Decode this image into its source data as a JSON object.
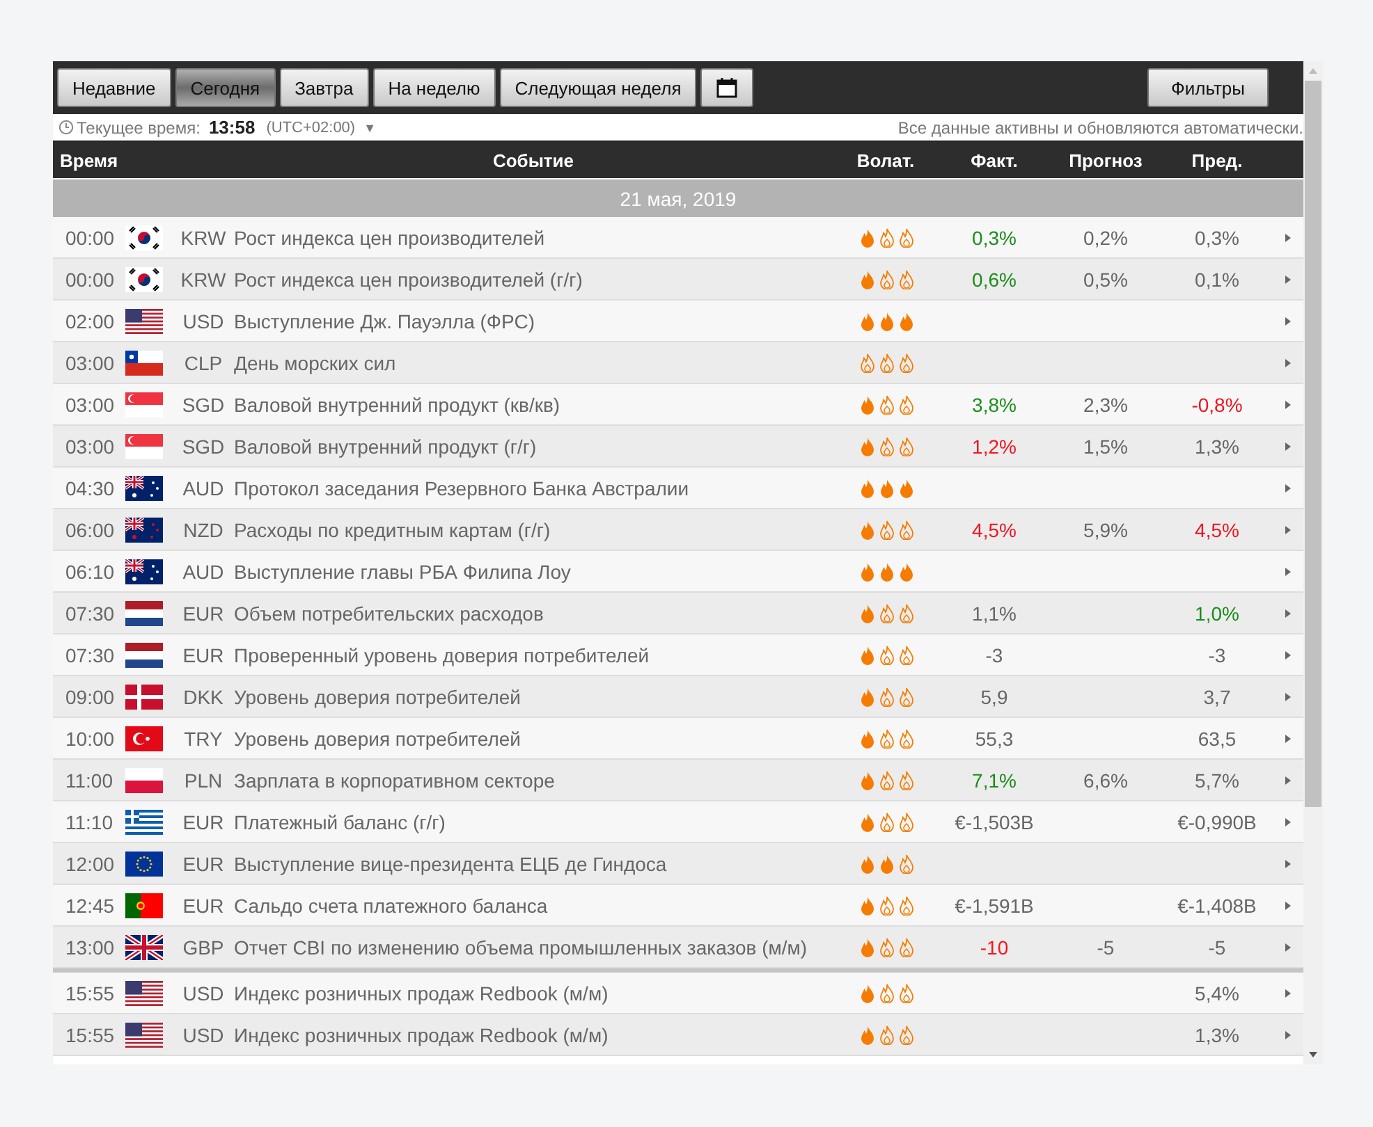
{
  "toolbar": {
    "tabs": [
      {
        "label": "Недавние",
        "selected": false
      },
      {
        "label": "Сегодня",
        "selected": true
      },
      {
        "label": "Завтра",
        "selected": false
      },
      {
        "label": "На неделю",
        "selected": false
      },
      {
        "label": "Следующая неделя",
        "selected": false
      }
    ],
    "filters_button": "Фильтры"
  },
  "info": {
    "clock_label": "Текущее время:",
    "time": "13:58",
    "timezone": "(UTC+02:00)",
    "timezone_caret": "▼",
    "status": "Все данные активны и обновляются автоматически."
  },
  "table": {
    "columns": [
      "Время",
      "Событие",
      "Волат.",
      "Факт.",
      "Прогноз",
      "Пред."
    ],
    "date": "21 мая, 2019",
    "rows": [
      {
        "time": "00:00",
        "kind": "kr",
        "currency": "KRW",
        "event": "Рост индекса цен производителей",
        "stars": 1,
        "actual": {
          "text": "0,3%",
          "color": "#1a8c1a"
        },
        "forecast": "0,2%",
        "previous": {
          "text": "0,3%",
          "color": "#666666"
        }
      },
      {
        "time": "00:00",
        "kind": "kr",
        "currency": "KRW",
        "event": "Рост индекса цен производителей (г/г)",
        "stars": 1,
        "actual": {
          "text": "0,6%",
          "color": "#1a8c1a"
        },
        "forecast": "0,5%",
        "previous": {
          "text": "0,1%",
          "color": "#666666"
        }
      },
      {
        "time": "02:00",
        "kind": "us",
        "currency": "USD",
        "event": "Выступление Дж. Пауэлла (ФРС)",
        "stars": 3
      },
      {
        "time": "03:00",
        "kind": "cl",
        "currency": "CLP",
        "event": "День морских сил",
        "stars": 0
      },
      {
        "time": "03:00",
        "kind": "sg",
        "currency": "SGD",
        "event": "Валовой внутренний продукт (кв/кв)",
        "stars": 1,
        "actual": {
          "text": "3,8%",
          "color": "#1a8c1a"
        },
        "forecast": "2,3%",
        "previous": {
          "text": "-0,8%",
          "color": "#f0141e"
        }
      },
      {
        "time": "03:00",
        "kind": "sg",
        "currency": "SGD",
        "event": "Валовой внутренний продукт (г/г)",
        "stars": 1,
        "actual": {
          "text": "1,2%",
          "color": "#f0141e"
        },
        "forecast": "1,5%",
        "previous": {
          "text": "1,3%",
          "color": "#666666"
        }
      },
      {
        "time": "04:30",
        "kind": "au",
        "currency": "AUD",
        "event": "Протокол заседания Резервного Банка Австралии",
        "stars": 3
      },
      {
        "time": "06:00",
        "kind": "nz",
        "currency": "NZD",
        "event": "Расходы по кредитным картам (г/г)",
        "stars": 1,
        "actual": {
          "text": "4,5%",
          "color": "#f0141e"
        },
        "forecast": "5,9%",
        "previous": {
          "text": "4,5%",
          "color": "#f0141e"
        }
      },
      {
        "time": "06:10",
        "kind": "au",
        "currency": "AUD",
        "event": "Выступление главы РБА Филипа Лоу",
        "stars": 3
      },
      {
        "time": "07:30",
        "kind": "nl",
        "currency": "EUR",
        "event": "Объем потребительских расходов",
        "stars": 1,
        "actual": {
          "text": "1,1%",
          "color": "#666666"
        },
        "previous": {
          "text": "1,0%",
          "color": "#1a8c1a"
        }
      },
      {
        "time": "07:30",
        "kind": "nl",
        "currency": "EUR",
        "event": "Проверенный уровень доверия потребителей",
        "stars": 1,
        "actual": {
          "text": "-3",
          "color": "#666666"
        },
        "previous": {
          "text": "-3",
          "color": "#666666"
        }
      },
      {
        "time": "09:00",
        "kind": "dk",
        "currency": "DKK",
        "event": "Уровень доверия потребителей",
        "stars": 1,
        "actual": {
          "text": "5,9",
          "color": "#666666"
        },
        "previous": {
          "text": "3,7",
          "color": "#666666"
        }
      },
      {
        "time": "10:00",
        "kind": "tr",
        "currency": "TRY",
        "event": "Уровень доверия потребителей",
        "stars": 1,
        "actual": {
          "text": "55,3",
          "color": "#666666"
        },
        "previous": {
          "text": "63,5",
          "color": "#666666"
        }
      },
      {
        "time": "11:00",
        "kind": "pl",
        "currency": "PLN",
        "event": "Зарплата в корпоративном секторе",
        "stars": 1,
        "actual": {
          "text": "7,1%",
          "color": "#1a8c1a"
        },
        "forecast": "6,6%",
        "previous": {
          "text": "5,7%",
          "color": "#666666"
        }
      },
      {
        "time": "11:10",
        "kind": "gr",
        "currency": "EUR",
        "event": "Платежный баланс (г/г)",
        "stars": 1,
        "actual": {
          "text": "€-1,503B",
          "color": "#666666"
        },
        "previous": {
          "text": "€-0,990B",
          "color": "#666666"
        }
      },
      {
        "time": "12:00",
        "kind": "eu",
        "currency": "EUR",
        "event": "Выступление вице-президента ЕЦБ де Гиндоса",
        "stars": 2
      },
      {
        "time": "12:45",
        "kind": "pt",
        "currency": "EUR",
        "event": "Сальдо счета платежного баланса",
        "stars": 1,
        "actual": {
          "text": "€-1,591B",
          "color": "#666666"
        },
        "previous": {
          "text": "€-1,408B",
          "color": "#666666"
        }
      },
      {
        "time": "13:00",
        "kind": "gb",
        "currency": "GBP",
        "event": "Отчет CBI по изменению объема промышленных заказов (м/м)",
        "stars": 1,
        "actual": {
          "text": "-10",
          "color": "#f0141e"
        },
        "forecast": "-5",
        "previous": {
          "text": "-5",
          "color": "#666666"
        }
      }
    ],
    "upcoming_rows": [
      {
        "time": "15:55",
        "kind": "us",
        "currency": "USD",
        "event": "Индекс розничных продаж Redbook (м/м)",
        "stars": 1,
        "previous": {
          "text": "5,4%",
          "color": "#666666"
        }
      },
      {
        "time": "15:55",
        "kind": "us",
        "currency": "USD",
        "event": "Индекс розничных продаж Redbook (м/м)",
        "stars": 1,
        "previous": {
          "text": "1,3%",
          "color": "#666666"
        }
      }
    ]
  }
}
